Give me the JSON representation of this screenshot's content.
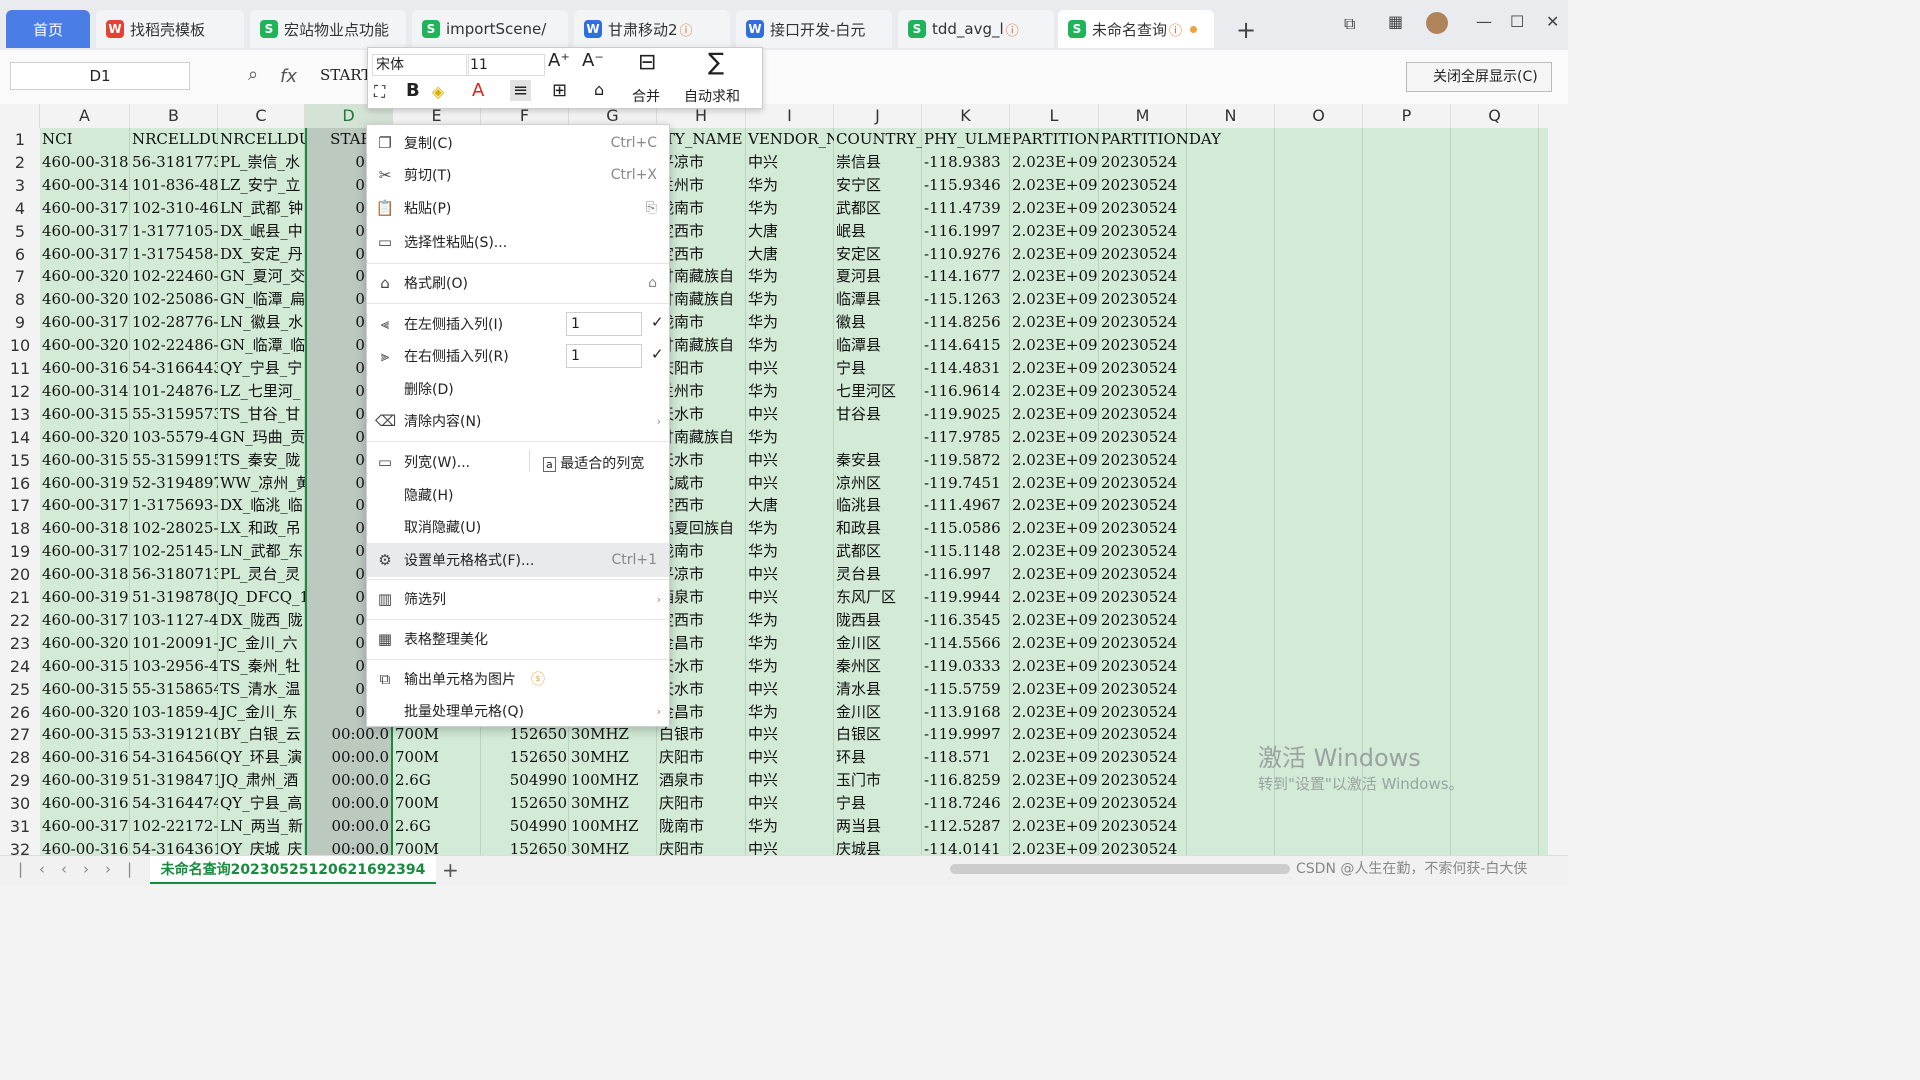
{
  "tabs": [
    {
      "label": "首页",
      "icon": "home"
    },
    {
      "label": "找稻壳模板",
      "icon": "docer-icon"
    },
    {
      "label": "宏站物业点功能",
      "icon": "sheet-icon"
    },
    {
      "label": "importScene/",
      "icon": "sheet-icon"
    },
    {
      "label": "甘肃移动2",
      "icon": "word-icon"
    },
    {
      "label": "接口开发-白元",
      "icon": "word-icon"
    },
    {
      "label": "tdd_avg_l",
      "icon": "sheet-icon"
    },
    {
      "label": "未命名查询",
      "icon": "sheet-icon"
    }
  ],
  "namebox": "D1",
  "formula": "START_",
  "close_fullscreen": "关闭全屏显示(C)",
  "columns": [
    "A",
    "B",
    "C",
    "D",
    "E",
    "F",
    "G",
    "H",
    "I",
    "J",
    "K",
    "L",
    "M",
    "N",
    "O",
    "P",
    "Q"
  ],
  "rows": [
    [
      "NCI",
      "NRCELLDU_I",
      "NRCELLDU_N",
      "START_",
      "",
      "",
      "",
      "ITY_NAME",
      "VENDOR_NAM",
      "COUNTRY_NA",
      "PHY_ULMEAN",
      "PARTITIONI",
      "PARTITIONDAY"
    ],
    [
      "460-00-318",
      "56-3181773",
      "PL_崇信_水",
      "00:0",
      "",
      "",
      "",
      "平凉市",
      "中兴",
      "崇信县",
      "-118.9383",
      "2.023E+09",
      "20230524"
    ],
    [
      "460-00-314",
      "101-836-48",
      "LZ_安宁_立",
      "00:0",
      "",
      "",
      "",
      "兰州市",
      "华为",
      "安宁区",
      "-115.9346",
      "2.023E+09",
      "20230524"
    ],
    [
      "460-00-317",
      "102-310-46",
      "LN_武都_钟",
      "00:0",
      "",
      "",
      "",
      "陇南市",
      "华为",
      "武都区",
      "-111.4739",
      "2.023E+09",
      "20230524"
    ],
    [
      "460-00-317",
      "1-3177105-",
      "DX_岷县_中",
      "00:0",
      "",
      "",
      "",
      "定西市",
      "大唐",
      "岷县",
      "-116.1997",
      "2.023E+09",
      "20230524"
    ],
    [
      "460-00-317",
      "1-3175458-",
      "DX_安定_丹",
      "00:0",
      "",
      "",
      "",
      "定西市",
      "大唐",
      "安定区",
      "-110.9276",
      "2.023E+09",
      "20230524"
    ],
    [
      "460-00-320",
      "102-22460-",
      "GN_夏河_交",
      "00:0",
      "",
      "",
      "",
      "甘南藏族自",
      "华为",
      "夏河县",
      "-114.1677",
      "2.023E+09",
      "20230524"
    ],
    [
      "460-00-320",
      "102-25086-",
      "GN_临潭_扁",
      "00:0",
      "",
      "",
      "",
      "甘南藏族自",
      "华为",
      "临潭县",
      "-115.1263",
      "2.023E+09",
      "20230524"
    ],
    [
      "460-00-317",
      "102-28776-",
      "LN_徽县_水",
      "00:0",
      "",
      "",
      "",
      "陇南市",
      "华为",
      "徽县",
      "-114.8256",
      "2.023E+09",
      "20230524"
    ],
    [
      "460-00-320",
      "102-22486-",
      "GN_临潭_临",
      "00:0",
      "",
      "",
      "",
      "甘南藏族自",
      "华为",
      "临潭县",
      "-114.6415",
      "2.023E+09",
      "20230524"
    ],
    [
      "460-00-316",
      "54-3166443",
      "QY_宁县_宁",
      "00:0",
      "",
      "",
      "",
      "庆阳市",
      "中兴",
      "宁县",
      "-114.4831",
      "2.023E+09",
      "20230524"
    ],
    [
      "460-00-314",
      "101-24876-",
      "LZ_七里河_",
      "00:0",
      "",
      "",
      "",
      "兰州市",
      "华为",
      "七里河区",
      "-116.9614",
      "2.023E+09",
      "20230524"
    ],
    [
      "460-00-315",
      "55-3159573",
      "TS_甘谷_甘",
      "00:0",
      "",
      "",
      "",
      "天水市",
      "中兴",
      "甘谷县",
      "-119.9025",
      "2.023E+09",
      "20230524"
    ],
    [
      "460-00-320",
      "103-5579-4",
      "GN_玛曲_贡",
      "00:0",
      "",
      "",
      "",
      "甘南藏族自",
      "华为",
      "",
      "-117.9785",
      "2.023E+09",
      "20230524"
    ],
    [
      "460-00-315",
      "55-3159915",
      "TS_秦安_陇",
      "00:0",
      "",
      "",
      "",
      "天水市",
      "中兴",
      "秦安县",
      "-119.5872",
      "2.023E+09",
      "20230524"
    ],
    [
      "460-00-319",
      "52-3194897",
      "WW_凉州_黄",
      "00:0",
      "",
      "",
      "",
      "武威市",
      "中兴",
      "凉州区",
      "-119.7451",
      "2.023E+09",
      "20230524"
    ],
    [
      "460-00-317",
      "1-3175693-",
      "DX_临洮_临",
      "00:0",
      "",
      "",
      "",
      "定西市",
      "大唐",
      "临洮县",
      "-111.4967",
      "2.023E+09",
      "20230524"
    ],
    [
      "460-00-318",
      "102-28025-",
      "LX_和政_吊",
      "00:0",
      "",
      "",
      "",
      "临夏回族自",
      "华为",
      "和政县",
      "-115.0586",
      "2.023E+09",
      "20230524"
    ],
    [
      "460-00-317",
      "102-25145-",
      "LN_武都_东",
      "00:0",
      "",
      "",
      "",
      "陇南市",
      "华为",
      "武都区",
      "-115.1148",
      "2.023E+09",
      "20230524"
    ],
    [
      "460-00-318",
      "56-3180713",
      "PL_灵台_灵",
      "00:0",
      "",
      "",
      "",
      "平凉市",
      "中兴",
      "灵台县",
      "-116.997",
      "2.023E+09",
      "20230524"
    ],
    [
      "460-00-319",
      "51-3198780",
      "JQ_DFCQ_10",
      "00:0",
      "",
      "",
      "",
      "酒泉市",
      "中兴",
      "东风厂区",
      "-119.9944",
      "2.023E+09",
      "20230524"
    ],
    [
      "460-00-317",
      "103-1127-4",
      "DX_陇西_陇",
      "00:0",
      "",
      "",
      "",
      "定西市",
      "华为",
      "陇西县",
      "-116.3545",
      "2.023E+09",
      "20230524"
    ],
    [
      "460-00-320",
      "101-20091-",
      "JC_金川_六",
      "00:0",
      "",
      "",
      "",
      "金昌市",
      "华为",
      "金川区",
      "-114.5566",
      "2.023E+09",
      "20230524"
    ],
    [
      "460-00-315",
      "103-2956-4",
      "TS_秦州_牡",
      "00:0",
      "",
      "",
      "",
      "天水市",
      "华为",
      "秦州区",
      "-119.0333",
      "2.023E+09",
      "20230524"
    ],
    [
      "460-00-315",
      "55-3158654",
      "TS_清水_温",
      "00:0",
      "",
      "",
      "",
      "天水市",
      "中兴",
      "清水县",
      "-115.5759",
      "2.023E+09",
      "20230524"
    ],
    [
      "460-00-320",
      "103-1859-4",
      "JC_金川_东",
      "00:0",
      "",
      "",
      "",
      "金昌市",
      "华为",
      "金川区",
      "-113.9168",
      "2.023E+09",
      "20230524"
    ],
    [
      "460-00-315",
      "53-3191210",
      "BY_白银_云",
      "00:00.0",
      "700M",
      "152650",
      "30MHZ",
      "白银市",
      "中兴",
      "白银区",
      "-119.9997",
      "2.023E+09",
      "20230524"
    ],
    [
      "460-00-316",
      "54-3164560",
      "QY_环县_演",
      "00:00.0",
      "700M",
      "152650",
      "30MHZ",
      "庆阳市",
      "中兴",
      "环县",
      "-118.571",
      "2.023E+09",
      "20230524"
    ],
    [
      "460-00-319",
      "51-3198471",
      "JQ_肃州_酒",
      "00:00.0",
      "2.6G",
      "504990",
      "100MHZ",
      "酒泉市",
      "中兴",
      "玉门市",
      "-116.8259",
      "2.023E+09",
      "20230524"
    ],
    [
      "460-00-316",
      "54-3164474",
      "QY_宁县_高",
      "00:00.0",
      "700M",
      "152650",
      "30MHZ",
      "庆阳市",
      "中兴",
      "宁县",
      "-118.7246",
      "2.023E+09",
      "20230524"
    ],
    [
      "460-00-317",
      "102-22172-",
      "LN_两当_新",
      "00:00.0",
      "2.6G",
      "504990",
      "100MHZ",
      "陇南市",
      "华为",
      "两当县",
      "-112.5287",
      "2.023E+09",
      "20230524"
    ],
    [
      "460-00-316",
      "54-3164361",
      "QY_庆城_庆",
      "00:00.0",
      "700M",
      "152650",
      "30MHZ",
      "庆阳市",
      "中兴",
      "庆城县",
      "-114.0141",
      "2.023E+09",
      "20230524"
    ]
  ],
  "mini_toolbar": {
    "font": "宋体",
    "size": "11",
    "merge": "合并",
    "autosum": "自动求和"
  },
  "menu": {
    "copy": "复制(C)",
    "copy_sc": "Ctrl+C",
    "cut": "剪切(T)",
    "cut_sc": "Ctrl+X",
    "paste": "粘贴(P)",
    "paste_special": "选择性粘贴(S)...",
    "format_painter": "格式刷(O)",
    "insert_left": "在左侧插入列(I)",
    "insert_left_n": "1",
    "insert_right": "在右侧插入列(R)",
    "insert_right_n": "1",
    "delete": "删除(D)",
    "clear": "清除内容(N)",
    "col_width": "列宽(W)...",
    "best_fit": "最适合的列宽",
    "hide": "隐藏(H)",
    "unhide": "取消隐藏(U)",
    "format_cells": "设置单元格格式(F)...",
    "format_cells_sc": "Ctrl+1",
    "filter": "筛选列",
    "beautify": "表格整理美化",
    "export_image": "输出单元格为图片",
    "batch": "批量处理单元格(Q)"
  },
  "sheet_tab": "未命名查询20230525120621692394",
  "watermark": {
    "line1": "激活 Windows",
    "line2": "转到\"设置\"以激活 Windows。"
  },
  "credit": "CSDN @人生在勤，不索何获-白大侠"
}
